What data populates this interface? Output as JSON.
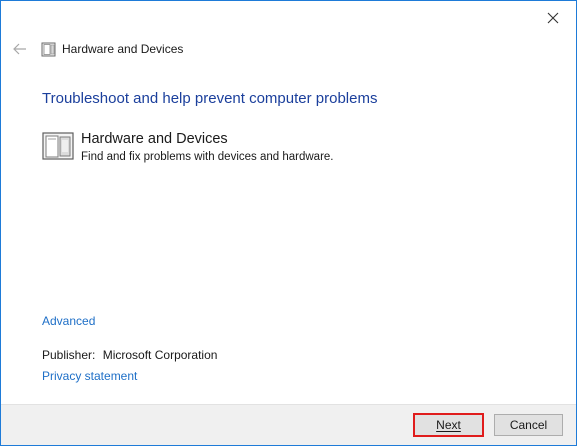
{
  "window": {
    "close_icon": "close-icon",
    "nav": {
      "back_icon": "back-arrow-icon",
      "icon": "hardware-devices-icon",
      "title": "Hardware and Devices"
    }
  },
  "main": {
    "heading": "Troubleshoot and help prevent computer problems",
    "item": {
      "icon": "hardware-devices-icon",
      "title": "Hardware and Devices",
      "description": "Find and fix problems with devices and hardware."
    },
    "advanced_link": "Advanced",
    "publisher_label": "Publisher:",
    "publisher_value": "Microsoft Corporation",
    "privacy_link": "Privacy statement"
  },
  "footer": {
    "next_label": "Next",
    "cancel_label": "Cancel"
  },
  "colors": {
    "window_border": "#1e7bd8",
    "heading": "#1b3f9c",
    "link": "#1e6fc7",
    "highlight": "#e01c1c"
  }
}
